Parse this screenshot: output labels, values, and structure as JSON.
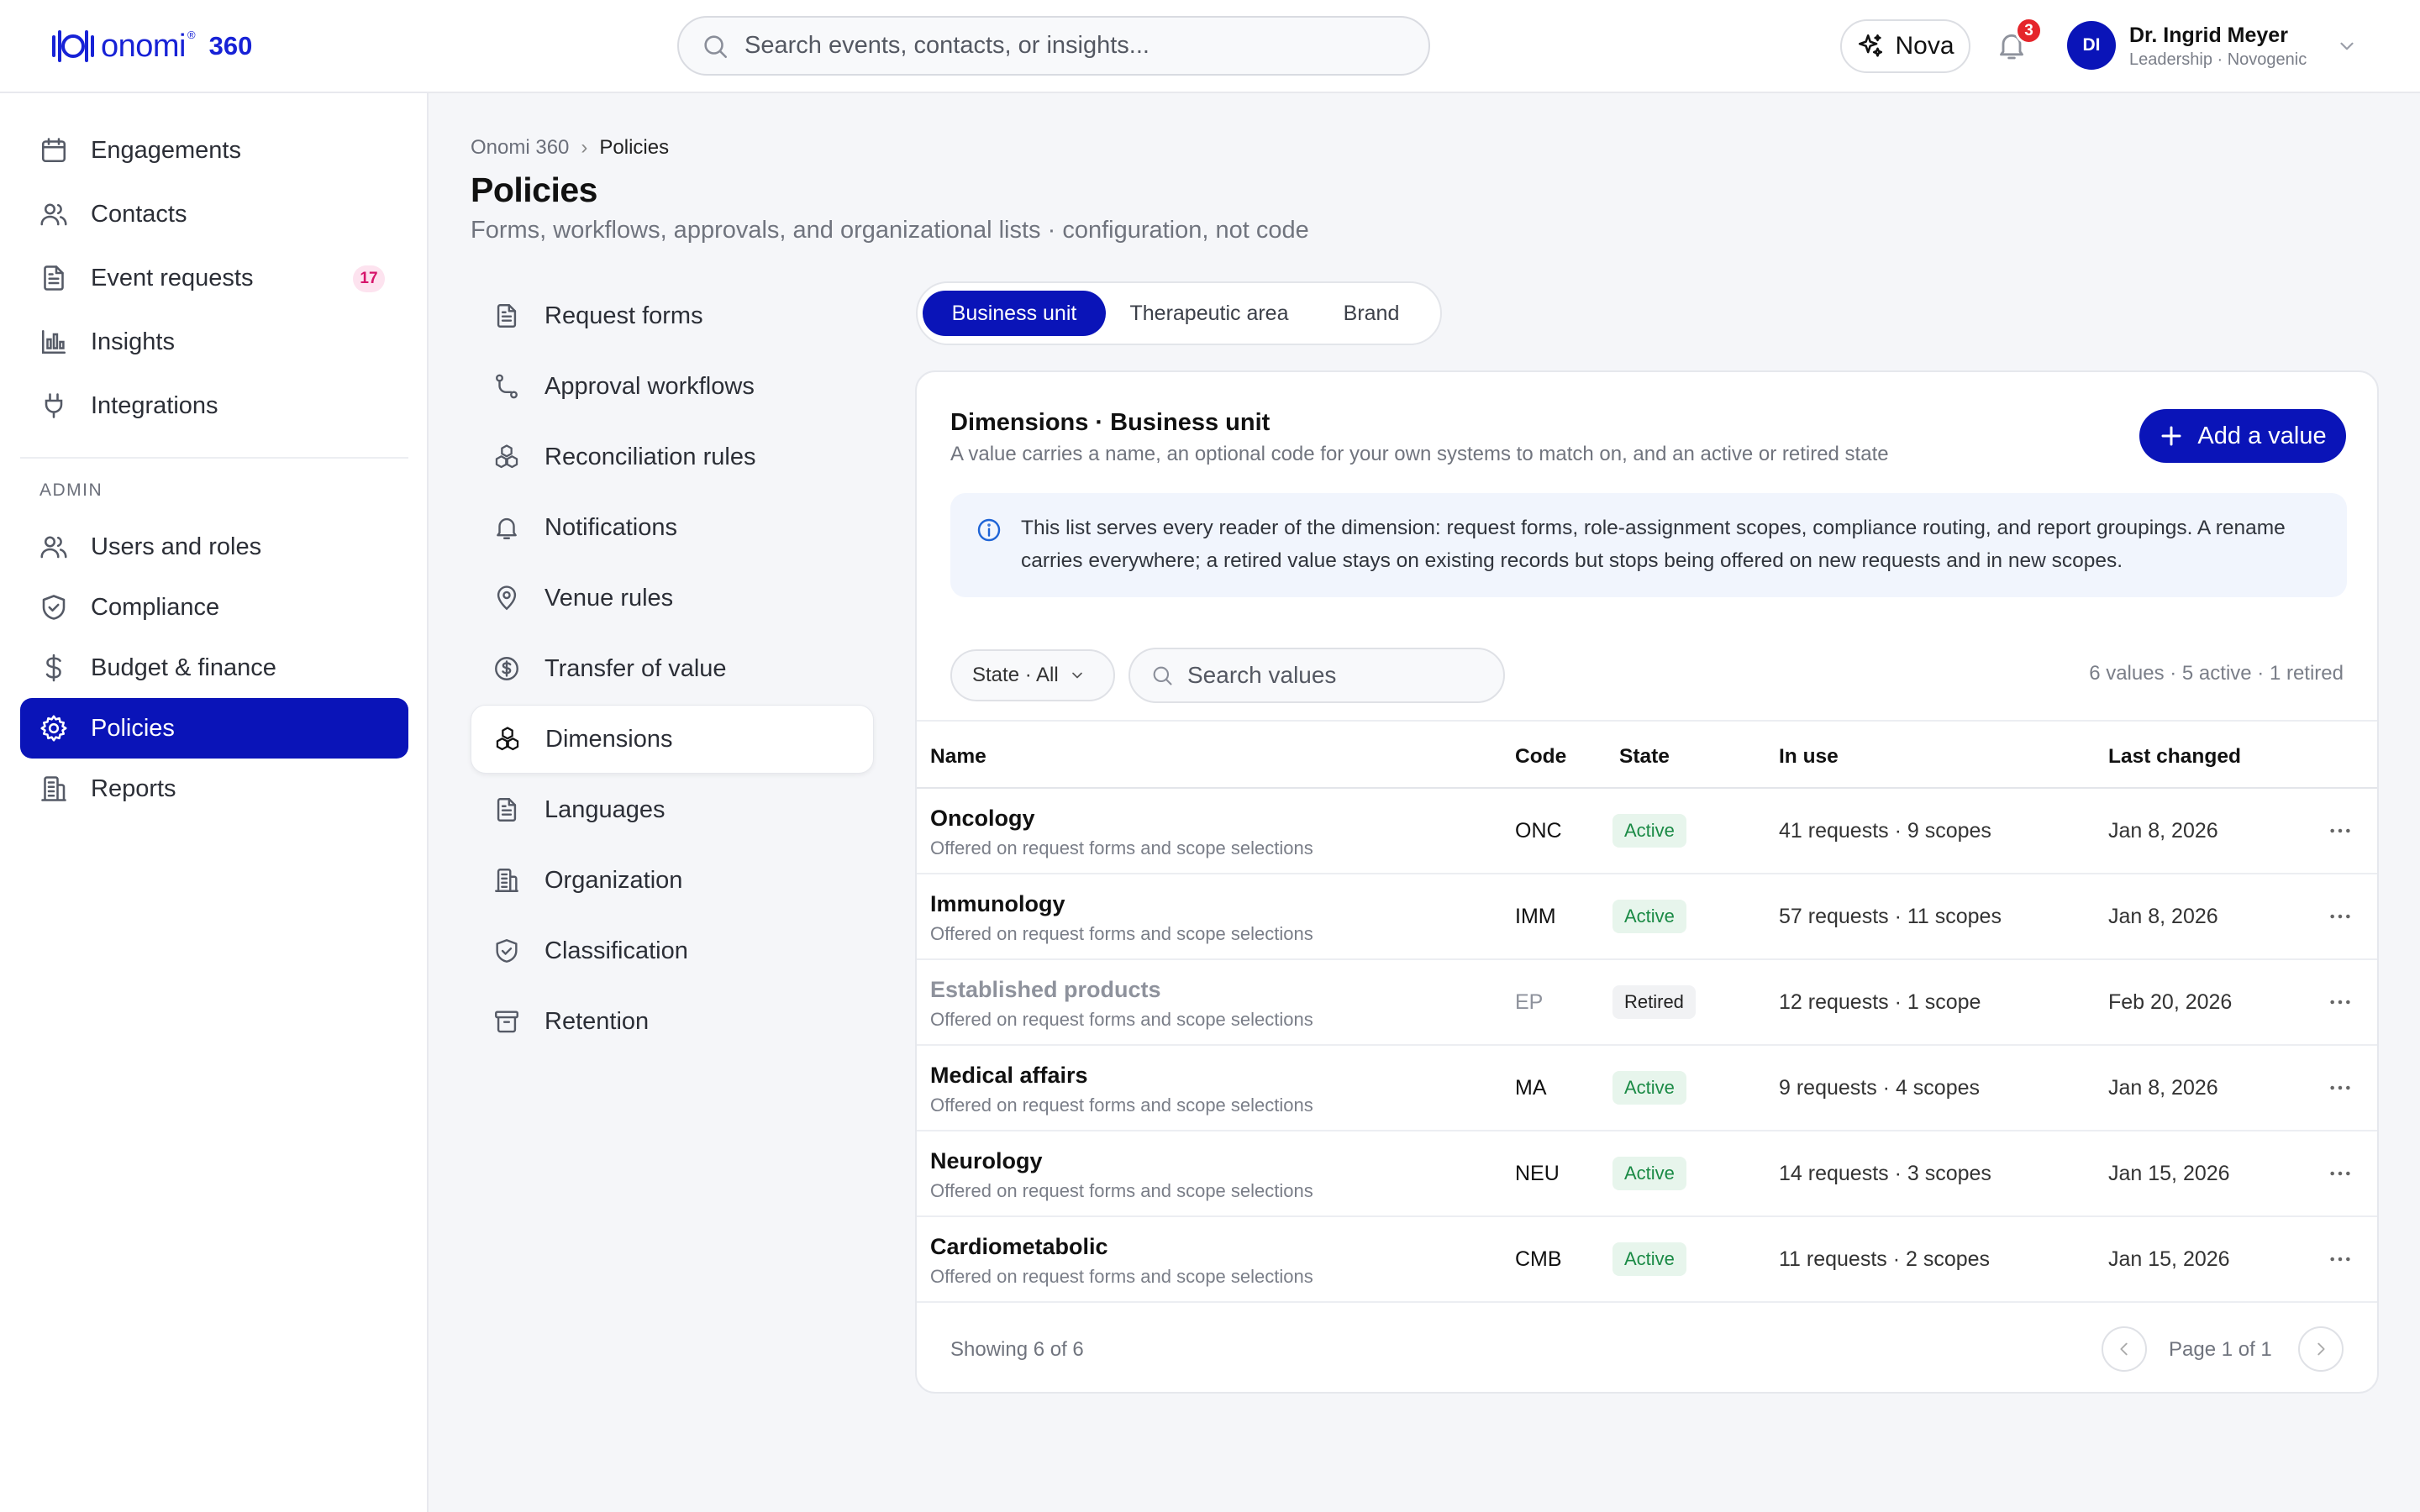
{
  "app": {
    "brand": "onomi",
    "reg": "®",
    "product": "360"
  },
  "header": {
    "search_placeholder": "Search events, contacts, or insights...",
    "nova_label": "Nova",
    "notification_count": "3",
    "user": {
      "initials": "DI",
      "name": "Dr. Ingrid Meyer",
      "role": "Leadership · Novogenic"
    }
  },
  "sidebar": {
    "items": [
      {
        "label": "Engagements",
        "icon": "calendar-icon"
      },
      {
        "label": "Contacts",
        "icon": "users-icon"
      },
      {
        "label": "Event requests",
        "icon": "document-icon",
        "badge": "17"
      },
      {
        "label": "Insights",
        "icon": "bar-chart-icon"
      },
      {
        "label": "Integrations",
        "icon": "plug-icon"
      }
    ],
    "admin_heading": "ADMIN",
    "admin_items": [
      {
        "label": "Users and roles",
        "icon": "users-icon"
      },
      {
        "label": "Compliance",
        "icon": "shield-icon"
      },
      {
        "label": "Budget & finance",
        "icon": "dollar-icon"
      },
      {
        "label": "Policies",
        "icon": "gear-icon",
        "active": true
      },
      {
        "label": "Reports",
        "icon": "building-icon"
      }
    ]
  },
  "breadcrumb": {
    "root": "Onomi 360",
    "sep": "›",
    "current": "Policies"
  },
  "page": {
    "title": "Policies",
    "subtitle": "Forms, workflows, approvals, and organizational lists · configuration, not code"
  },
  "subnav": [
    {
      "label": "Request forms",
      "icon": "document-icon"
    },
    {
      "label": "Approval workflows",
      "icon": "workflow-icon"
    },
    {
      "label": "Reconciliation rules",
      "icon": "cubes-icon"
    },
    {
      "label": "Notifications",
      "icon": "bell-icon"
    },
    {
      "label": "Venue rules",
      "icon": "pin-icon"
    },
    {
      "label": "Transfer of value",
      "icon": "dollar-circle-icon"
    },
    {
      "label": "Dimensions",
      "icon": "cubes-icon",
      "active": true
    },
    {
      "label": "Languages",
      "icon": "document-icon"
    },
    {
      "label": "Organization",
      "icon": "building-icon"
    },
    {
      "label": "Classification",
      "icon": "shield-icon"
    },
    {
      "label": "Retention",
      "icon": "archive-icon"
    }
  ],
  "tabs": [
    {
      "label": "Business unit",
      "active": true
    },
    {
      "label": "Therapeutic area"
    },
    {
      "label": "Brand"
    }
  ],
  "card": {
    "title": "Dimensions · Business unit",
    "subtitle": "A value carries a name, an optional code for your own systems to match on, and an active or retired state",
    "add_label": "Add a value",
    "info_text": "This list serves every reader of the dimension: request forms, role-assignment scopes, compliance routing, and report groupings. A rename carries everywhere; a retired value stays on existing records but stops being offered on new requests and in new scopes.",
    "filter_label": "State · All",
    "search_placeholder": "Search values",
    "counts": "6 values · 5 active · 1 retired"
  },
  "table": {
    "columns": [
      "Name",
      "Code",
      "State",
      "In use",
      "Last changed"
    ],
    "rows": [
      {
        "name": "Oncology",
        "desc": "Offered on request forms and scope selections",
        "code": "ONC",
        "state": "Active",
        "in_use": "41 requests · 9 scopes",
        "changed": "Jan 8, 2026"
      },
      {
        "name": "Immunology",
        "desc": "Offered on request forms and scope selections",
        "code": "IMM",
        "state": "Active",
        "in_use": "57 requests · 11 scopes",
        "changed": "Jan 8, 2026"
      },
      {
        "name": "Established products",
        "desc": "Offered on request forms and scope selections",
        "code": "EP",
        "state": "Retired",
        "in_use": "12 requests · 1 scope",
        "changed": "Feb 20, 2026"
      },
      {
        "name": "Medical affairs",
        "desc": "Offered on request forms and scope selections",
        "code": "MA",
        "state": "Active",
        "in_use": "9 requests · 4 scopes",
        "changed": "Jan 8, 2026"
      },
      {
        "name": "Neurology",
        "desc": "Offered on request forms and scope selections",
        "code": "NEU",
        "state": "Active",
        "in_use": "14 requests · 3 scopes",
        "changed": "Jan 15, 2026"
      },
      {
        "name": "Cardiometabolic",
        "desc": "Offered on request forms and scope selections",
        "code": "CMB",
        "state": "Active",
        "in_use": "11 requests · 2 scopes",
        "changed": "Jan 15, 2026"
      }
    ]
  },
  "footer": {
    "showing": "Showing 6 of 6",
    "page_label": "Page 1 of 1"
  },
  "colors": {
    "brand": "#0a14b8",
    "logo": "#1722d6",
    "active_state": "#1a8a45",
    "badge_pink": "#d6156b",
    "notification_red": "#e5252b"
  }
}
